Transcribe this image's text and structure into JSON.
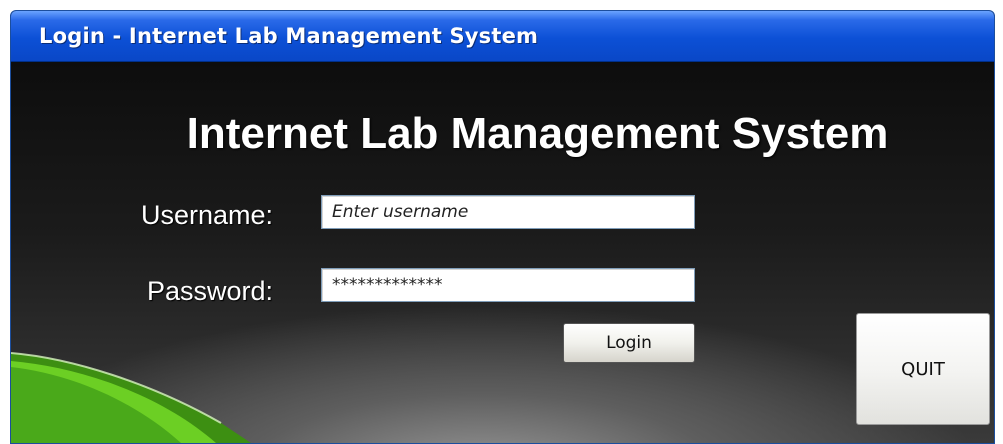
{
  "window": {
    "title": "Login - Internet Lab Management System"
  },
  "main": {
    "heading": "Internet Lab Management System",
    "username": {
      "label": "Username:",
      "placeholder": "Enter username"
    },
    "password": {
      "label": "Password:",
      "value": "*************"
    },
    "login_label": "Login",
    "quit_label": "QUIT"
  },
  "colors": {
    "titlebar": "#0c50d6",
    "background": "#1b1b1b",
    "accent_green": "#5cc21a"
  }
}
